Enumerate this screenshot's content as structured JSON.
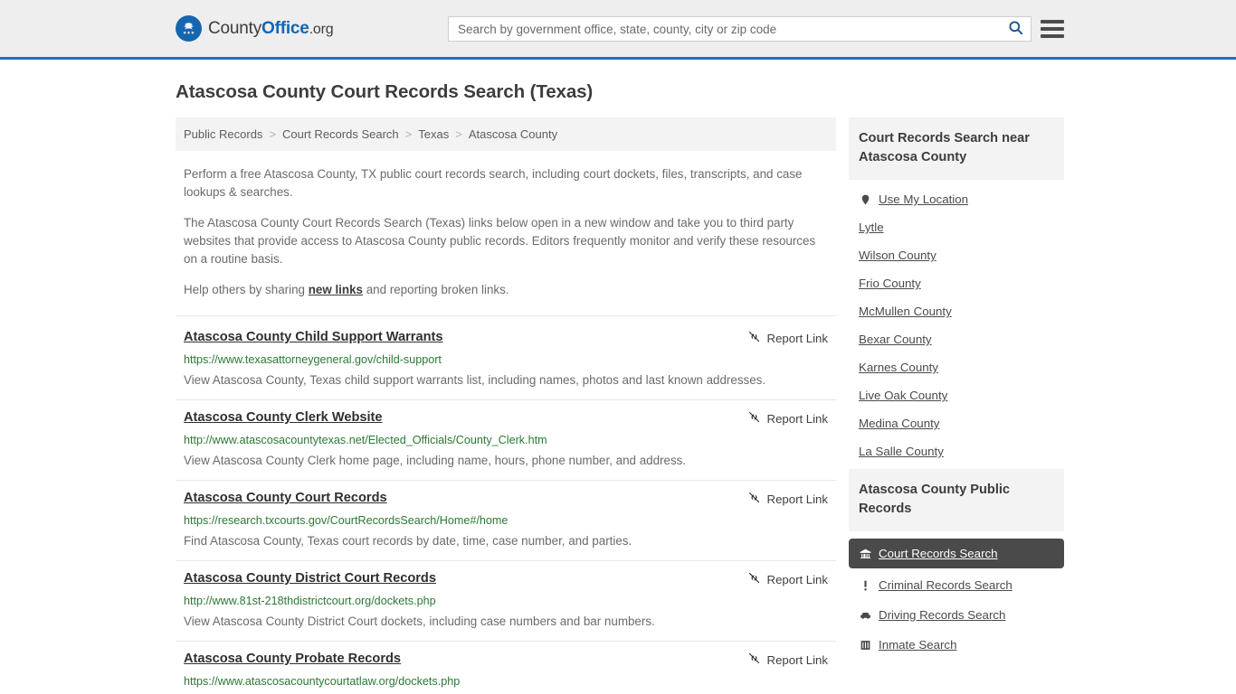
{
  "header": {
    "brand": {
      "part1": "County",
      "part2": "Office",
      "part3": ".org",
      "icon": "eagle-seal-icon"
    },
    "search": {
      "placeholder": "Search by government office, state, county, city or zip code",
      "value": "",
      "button_icon": "search-icon"
    },
    "menu_icon": "hamburger-menu-icon"
  },
  "page": {
    "title": "Atascosa County Court Records Search (Texas)"
  },
  "breadcrumb": {
    "separator": ">",
    "items": [
      {
        "label": "Public Records"
      },
      {
        "label": "Court Records Search"
      },
      {
        "label": "Texas"
      },
      {
        "label": "Atascosa County"
      }
    ]
  },
  "intro": {
    "p1": "Perform a free Atascosa County, TX public court records search, including court dockets, files, transcripts, and case lookups & searches.",
    "p2": "The Atascosa County Court Records Search (Texas) links below open in a new window and take you to third party websites that provide access to Atascosa County public records. Editors frequently monitor and verify these resources on a routine basis.",
    "p3_before": "Help others by sharing ",
    "p3_link": "new links",
    "p3_after": " and reporting broken links."
  },
  "report_link": {
    "label": "Report Link",
    "icon": "broken-link-icon"
  },
  "results": [
    {
      "title": "Atascosa County Child Support Warrants",
      "url": "https://www.texasattorneygeneral.gov/child-support",
      "description": "View Atascosa County, Texas child support warrants list, including names, photos and last known addresses."
    },
    {
      "title": "Atascosa County Clerk Website",
      "url": "http://www.atascosacountytexas.net/Elected_Officials/County_Clerk.htm",
      "description": "View Atascosa County Clerk home page, including name, hours, phone number, and address."
    },
    {
      "title": "Atascosa County Court Records",
      "url": "https://research.txcourts.gov/CourtRecordsSearch/Home#/home",
      "description": "Find Atascosa County, Texas court records by date, time, case number, and parties."
    },
    {
      "title": "Atascosa County District Court Records",
      "url": "http://www.81st-218thdistrictcourt.org/dockets.php",
      "description": "View Atascosa County District Court dockets, including case numbers and bar numbers."
    },
    {
      "title": "Atascosa County Probate Records",
      "url": "https://www.atascosacountycourtatlaw.org/dockets.php",
      "description": ""
    }
  ],
  "sidebar": {
    "nearby": {
      "heading": "Court Records Search near Atascosa County",
      "items": [
        {
          "label": "Use My Location",
          "icon": "map-pin-icon"
        },
        {
          "label": "Lytle",
          "icon": ""
        },
        {
          "label": "Wilson County",
          "icon": ""
        },
        {
          "label": "Frio County",
          "icon": ""
        },
        {
          "label": "McMullen County",
          "icon": ""
        },
        {
          "label": "Bexar County",
          "icon": ""
        },
        {
          "label": "Karnes County",
          "icon": ""
        },
        {
          "label": "Live Oak County",
          "icon": ""
        },
        {
          "label": "Medina County",
          "icon": ""
        },
        {
          "label": "La Salle County",
          "icon": ""
        }
      ]
    },
    "public_records": {
      "heading": "Atascosa County Public Records",
      "items": [
        {
          "label": "Court Records Search",
          "icon": "courthouse-icon",
          "active": true
        },
        {
          "label": "Criminal Records Search",
          "icon": "exclamation-icon",
          "active": false
        },
        {
          "label": "Driving Records Search",
          "icon": "car-icon",
          "active": false
        },
        {
          "label": "Inmate Search",
          "icon": "jail-icon",
          "active": false
        }
      ]
    }
  },
  "colors": {
    "brand_blue": "#1566b0",
    "header_bg": "#eeeeee",
    "header_border": "#2b6cab",
    "url_green": "#2a7a33",
    "active_bg": "#4a4a4a",
    "card_head_bg": "#f3f3f3"
  }
}
